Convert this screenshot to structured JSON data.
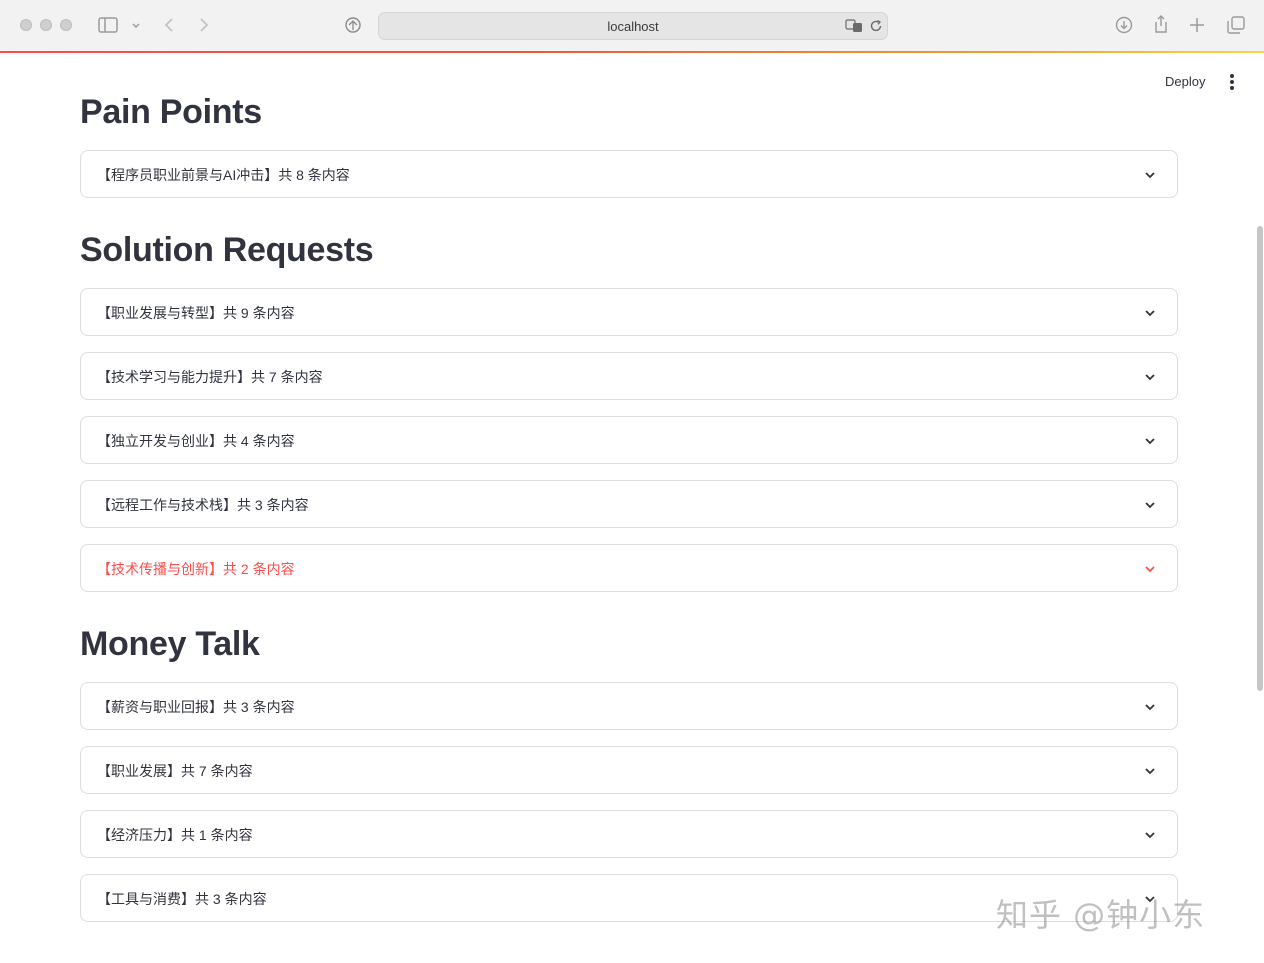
{
  "browser": {
    "url": "localhost"
  },
  "header": {
    "deploy_label": "Deploy"
  },
  "sections": [
    {
      "title": "Pain Points",
      "expanders": [
        {
          "label": "【程序员职业前景与AI冲击】共 8 条内容"
        }
      ]
    },
    {
      "title": "Solution Requests",
      "expanders": [
        {
          "label": "【职业发展与转型】共 9 条内容"
        },
        {
          "label": "【技术学习与能力提升】共 7 条内容"
        },
        {
          "label": "【独立开发与创业】共 4 条内容"
        },
        {
          "label": "【远程工作与技术栈】共 3 条内容"
        },
        {
          "label": "【技术传播与创新】共 2 条内容",
          "active": true
        }
      ]
    },
    {
      "title": "Money Talk",
      "expanders": [
        {
          "label": "【薪资与职业回报】共 3 条内容"
        },
        {
          "label": "【职业发展】共 7 条内容"
        },
        {
          "label": "【经济压力】共 1 条内容"
        },
        {
          "label": "【工具与消费】共 3 条内容"
        }
      ]
    }
  ],
  "watermark": "知乎 @钟小东",
  "colors": {
    "accent": "#ff4b4b",
    "text": "#31333f",
    "border": "#dcdde0"
  }
}
